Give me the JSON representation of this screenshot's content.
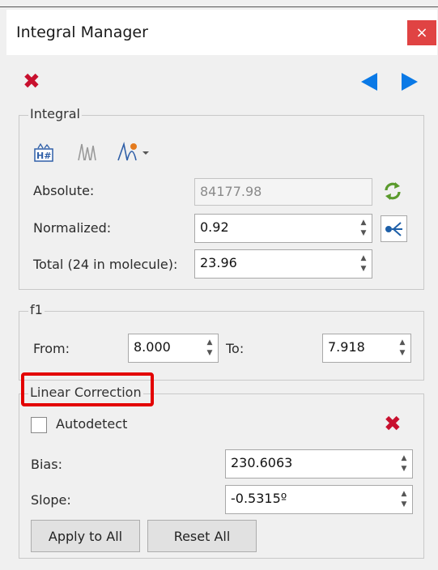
{
  "window": {
    "title": "Integral Manager",
    "close_glyph": "×"
  },
  "toolbar": {
    "delete_icon": "red-x-icon",
    "prev_icon": "left-arrow-icon",
    "next_icon": "right-arrow-icon"
  },
  "integral": {
    "group_label": "Integral",
    "absolute_label": "Absolute:",
    "absolute_value": "84177.98",
    "normalized_label": "Normalized:",
    "normalized_value": "0.92",
    "total_label": "Total (24 in molecule):",
    "total_value": "23.96"
  },
  "f1": {
    "group_label": "f1",
    "from_label": "From:",
    "from_value": "8.000",
    "to_label": "To:",
    "to_value": "7.918"
  },
  "linear_correction": {
    "group_label": "Linear Correction",
    "autodetect_label": "Autodetect",
    "bias_label": "Bias:",
    "bias_value": "230.6063",
    "slope_label": "Slope:",
    "slope_value": "-0.5315º",
    "apply_label": "Apply to All",
    "reset_label": "Reset All"
  },
  "colors": {
    "accent_blue": "#0a79e6",
    "delete_red": "#c8102e",
    "highlight_red": "#e30000"
  }
}
